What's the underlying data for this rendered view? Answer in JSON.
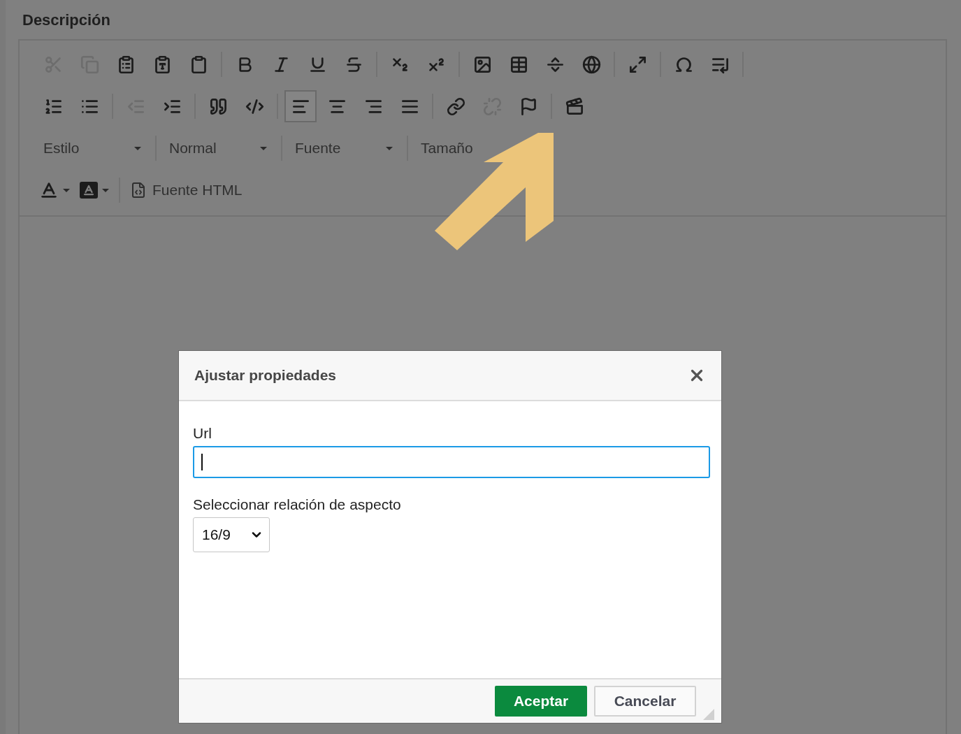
{
  "section_title": "Descripción",
  "toolbar": {
    "icon_rows": [
      [
        [
          {
            "kind": "cut",
            "disabled": true,
            "selected": false
          },
          {
            "kind": "copy",
            "disabled": true,
            "selected": false
          },
          {
            "kind": "paste",
            "disabled": false,
            "selected": false
          },
          {
            "kind": "paste_text",
            "disabled": false,
            "selected": false
          },
          {
            "kind": "paste_word",
            "disabled": false,
            "selected": false
          }
        ],
        [
          {
            "kind": "bold",
            "disabled": false,
            "selected": false
          },
          {
            "kind": "italic",
            "disabled": false,
            "selected": false
          },
          {
            "kind": "underline",
            "disabled": false,
            "selected": false
          },
          {
            "kind": "strike",
            "disabled": false,
            "selected": false
          }
        ],
        [
          {
            "kind": "subscript",
            "disabled": false,
            "selected": false
          },
          {
            "kind": "superscript",
            "disabled": false,
            "selected": false
          }
        ],
        [
          {
            "kind": "image",
            "disabled": false,
            "selected": false
          },
          {
            "kind": "table",
            "disabled": false,
            "selected": false
          },
          {
            "kind": "rule",
            "disabled": false,
            "selected": false
          },
          {
            "kind": "globe",
            "disabled": false,
            "selected": false
          }
        ],
        [
          {
            "kind": "maximize",
            "disabled": false,
            "selected": false
          }
        ],
        [
          {
            "kind": "omega",
            "disabled": false,
            "selected": false
          },
          {
            "kind": "pagebreak",
            "disabled": false,
            "selected": false
          }
        ]
      ],
      [
        [
          {
            "kind": "ordered",
            "disabled": false,
            "selected": false
          },
          {
            "kind": "bullets",
            "disabled": false,
            "selected": false
          }
        ],
        [
          {
            "kind": "outdent",
            "disabled": true,
            "selected": false
          },
          {
            "kind": "indent",
            "disabled": false,
            "selected": false
          }
        ],
        [
          {
            "kind": "quote",
            "disabled": false,
            "selected": false
          },
          {
            "kind": "div",
            "disabled": false,
            "selected": false
          }
        ],
        [
          {
            "kind": "left",
            "disabled": false,
            "selected": true
          },
          {
            "kind": "center",
            "disabled": false,
            "selected": false
          },
          {
            "kind": "right",
            "disabled": false,
            "selected": false
          },
          {
            "kind": "justify",
            "disabled": false,
            "selected": false
          }
        ],
        [
          {
            "kind": "link",
            "disabled": false,
            "selected": false
          },
          {
            "kind": "unlink",
            "disabled": true,
            "selected": false
          },
          {
            "kind": "flag",
            "disabled": false,
            "selected": false
          }
        ],
        [
          {
            "kind": "video",
            "disabled": false,
            "selected": false
          }
        ]
      ]
    ],
    "dropdowns": [
      {
        "label": "Estilo"
      },
      {
        "label": "Normal"
      },
      {
        "label": "Fuente"
      },
      {
        "label": "Tamaño"
      }
    ],
    "color_buttons": [
      {
        "kind": "text_color"
      },
      {
        "kind": "background_color"
      }
    ],
    "source_button": {
      "label": "Fuente HTML"
    }
  },
  "dialog": {
    "title": "Ajustar propiedades",
    "url_field": {
      "label": "Url",
      "focused": true
    },
    "aspect_field": {
      "label": "Seleccionar relación de aspecto",
      "value": "16/9"
    },
    "buttons": [
      {
        "label": "Aceptar",
        "primary": true
      },
      {
        "label": "Cancelar",
        "primary": false
      }
    ]
  }
}
